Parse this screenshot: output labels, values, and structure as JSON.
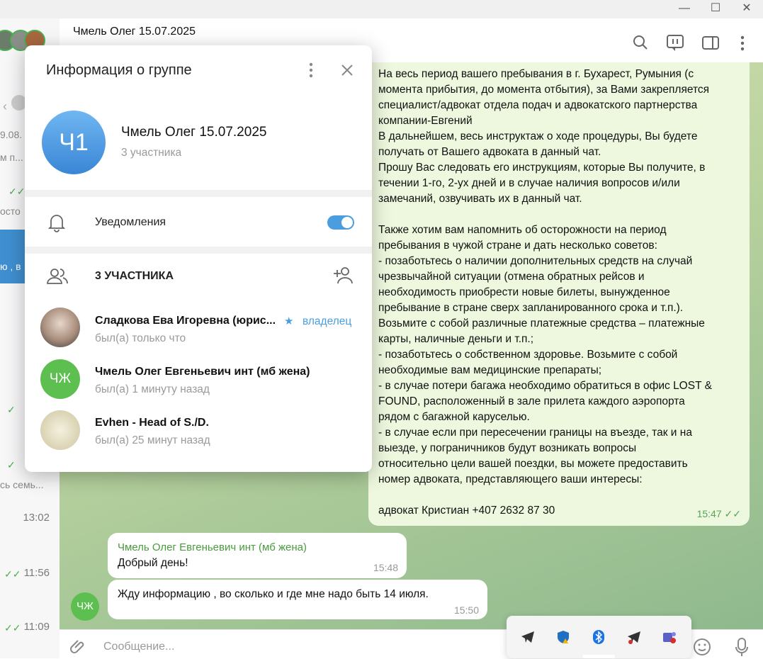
{
  "window": {
    "minimize": "—",
    "maximize": "☐",
    "close": "✕"
  },
  "chat": {
    "title": "Чмель Олег 15.07.2025",
    "big_message": "На весь период вашего пребывания в г. Бухарест, Румыния (с\nмомента прибытия, до момента отбытия), за Вами закрепляется\nспециалист/адвокат отдела подач и адвокатского партнерства\nкомпании-Евгений\nВ дальнейшем, весь инструктаж о ходе процедуры, Вы будете\nполучать от Вашего адвоката в данный чат.\nПрошу Вас следовать его инструкциям, которые Вы получите, в\nтечении 1-го, 2-ух дней и в случае наличия вопросов и/или\nзамечаний, озвучивать их в данный чат.\n\nТакже хотим вам напомнить об осторожности на период\nпребывания в чужой стране и дать несколько советов:\n- позаботьтесь о наличии дополнительных средств на случай\nчрезвычайной ситуации (отмена обратных рейсов и\nнеобходимость приобрести новые билеты, вынужденное\nпребывание в стране сверх запланированного срока и т.п.).\nВозьмите с собой различные платежные средства – платежные\nкарты, наличные деньги и т.п.;\n- позаботьтесь о собственном здоровье. Возьмите с собой\nнеобходимые вам медицинские препараты;\n- в случае потери багажа необходимо обратиться в офис LOST &\nFOUND, расположенный в зале прилета каждого аэропорта\nрядом с багажной каруселью.\n- в случае если при пересечении границы на въезде, так и на\nвыезде, у пограничников будут возникать вопросы\nотносительно цели вашей поездки, вы можете предоставить\nномер адвоката, представляющего ваши интересы:\n\nадвокат Кристиан +407 2632 87 30",
    "big_time": "15:47",
    "msg1_sender": "Чмель Олег Евгеньевич инт (мб жена)",
    "msg1_text": "Добрый день!",
    "msg1_time": "15:48",
    "msg2_text": "Жду информацию , во сколько и где мне надо быть 14 июля.",
    "msg2_time": "15:50",
    "msg_avatar": "ЧЖ",
    "input_placeholder": "Сообщение..."
  },
  "left": {
    "frag1": "9.08.",
    "frag2": "м п...",
    "frag3": "осто",
    "frag4": "ю , в",
    "frag5": "сь семь...",
    "times": [
      "13:02",
      "11:56",
      "11:09"
    ]
  },
  "modal": {
    "title": "Информация о группе",
    "avatar_initials": "Ч1",
    "group_name": "Чмель Олег 15.07.2025",
    "group_sub": "3 участника",
    "notifications_label": "Уведомления",
    "notifications_on": true,
    "members_header": "3 УЧАСТНИКА",
    "members": [
      {
        "name": "Сладкова Ева Игоревна (юрис...",
        "status": "был(а) только что",
        "role": "владелец"
      },
      {
        "name": "Чмель Олег Евгеньевич инт (мб жена)",
        "status": "был(а) 1 минуту назад",
        "initials": "ЧЖ"
      },
      {
        "name": "Evhen - Head of S./D.",
        "status": "был(а) 25 минут назад"
      }
    ]
  },
  "colors": {
    "accent": "#4a9ee0",
    "green": "#4caf50"
  }
}
